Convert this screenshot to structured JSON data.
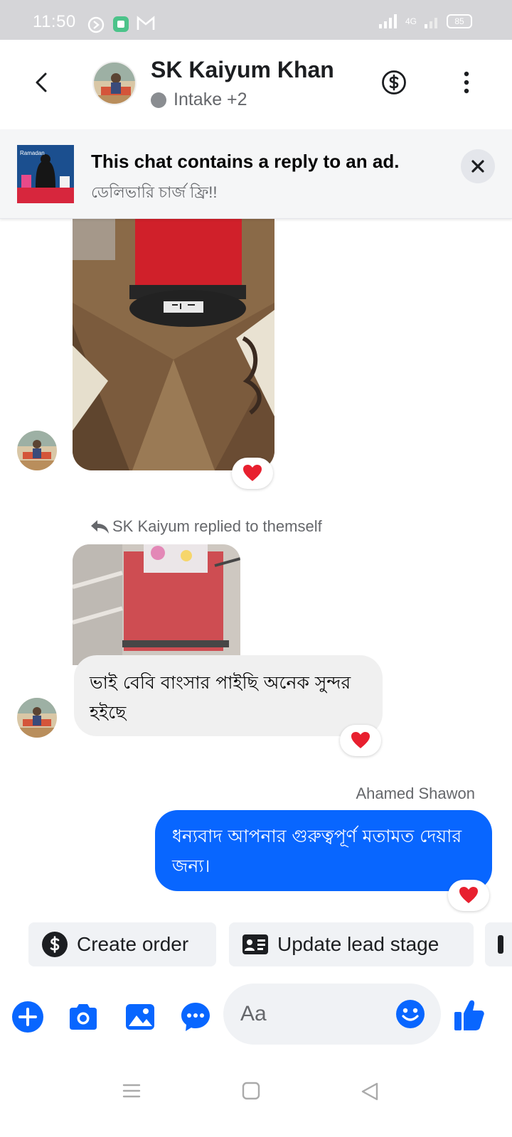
{
  "status_bar": {
    "time": "11:50",
    "network": "4G",
    "battery": "85"
  },
  "header": {
    "contact_name": "SK Kaiyum Khan",
    "status": "Intake +2",
    "icons": [
      "back-arrow-icon",
      "dollar-icon",
      "more-vertical-icon"
    ]
  },
  "ad_banner": {
    "title": "This chat contains a reply to an ad.",
    "subtitle": "ডেলিভারি চার্জ ফ্রি!!",
    "ad_image_text": "Ramadan"
  },
  "messages": {
    "reply_note": "SK Kaiyum replied to themself",
    "incoming_text": "ভাই বেবি বাংসার পাইছি অনেক সুন্দর হইছে",
    "outgoing_sender": "Ahamed Shawon",
    "outgoing_text": "ধন্যবাদ আপনার গুরুত্বপূর্ণ মতামত দেয়ার জন্য।",
    "reaction": "heart"
  },
  "actions": {
    "create_order": "Create order",
    "update_lead_stage": "Update lead stage"
  },
  "composer": {
    "placeholder": "Aa"
  },
  "colors": {
    "accent": "#0866ff",
    "heart": "#e8202f"
  }
}
